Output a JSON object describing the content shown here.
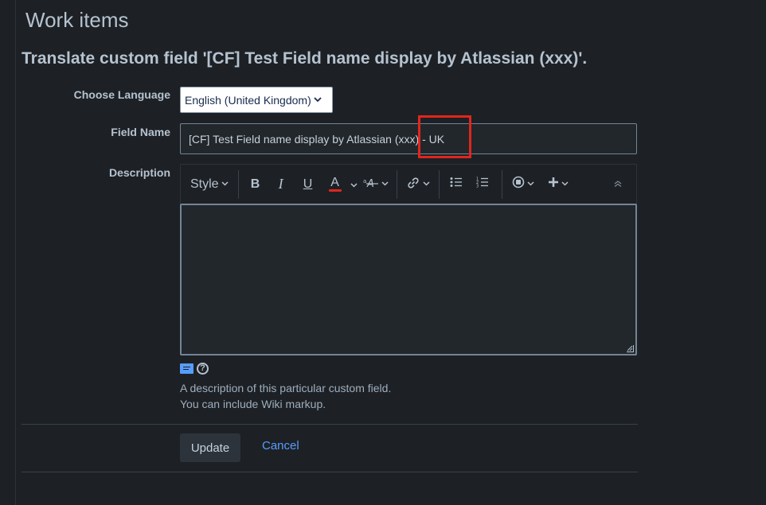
{
  "page": {
    "title": "Work items"
  },
  "form": {
    "heading": "Translate custom field '[CF] Test Field name display by Atlassian (xxx)'.",
    "language_label": "Choose Language",
    "language_selected": "English (United Kingdom)",
    "field_name_label": "Field Name",
    "field_name_value": "[CF] Test Field name display by Atlassian (xxx) - UK",
    "description_label": "Description",
    "description_value": "",
    "help_line_1": "A description of this particular custom field.",
    "help_line_2": "You can include Wiki markup.",
    "update_label": "Update",
    "cancel_label": "Cancel"
  },
  "toolbar": {
    "style_label": "Style",
    "bold_label": "B",
    "italic_label": "I",
    "underline_label": "U",
    "text_color_label": "A",
    "text_color_accent": "#e2251d"
  },
  "colors": {
    "background": "#1d2125",
    "highlight": "#e2251d",
    "link": "#579dff"
  }
}
